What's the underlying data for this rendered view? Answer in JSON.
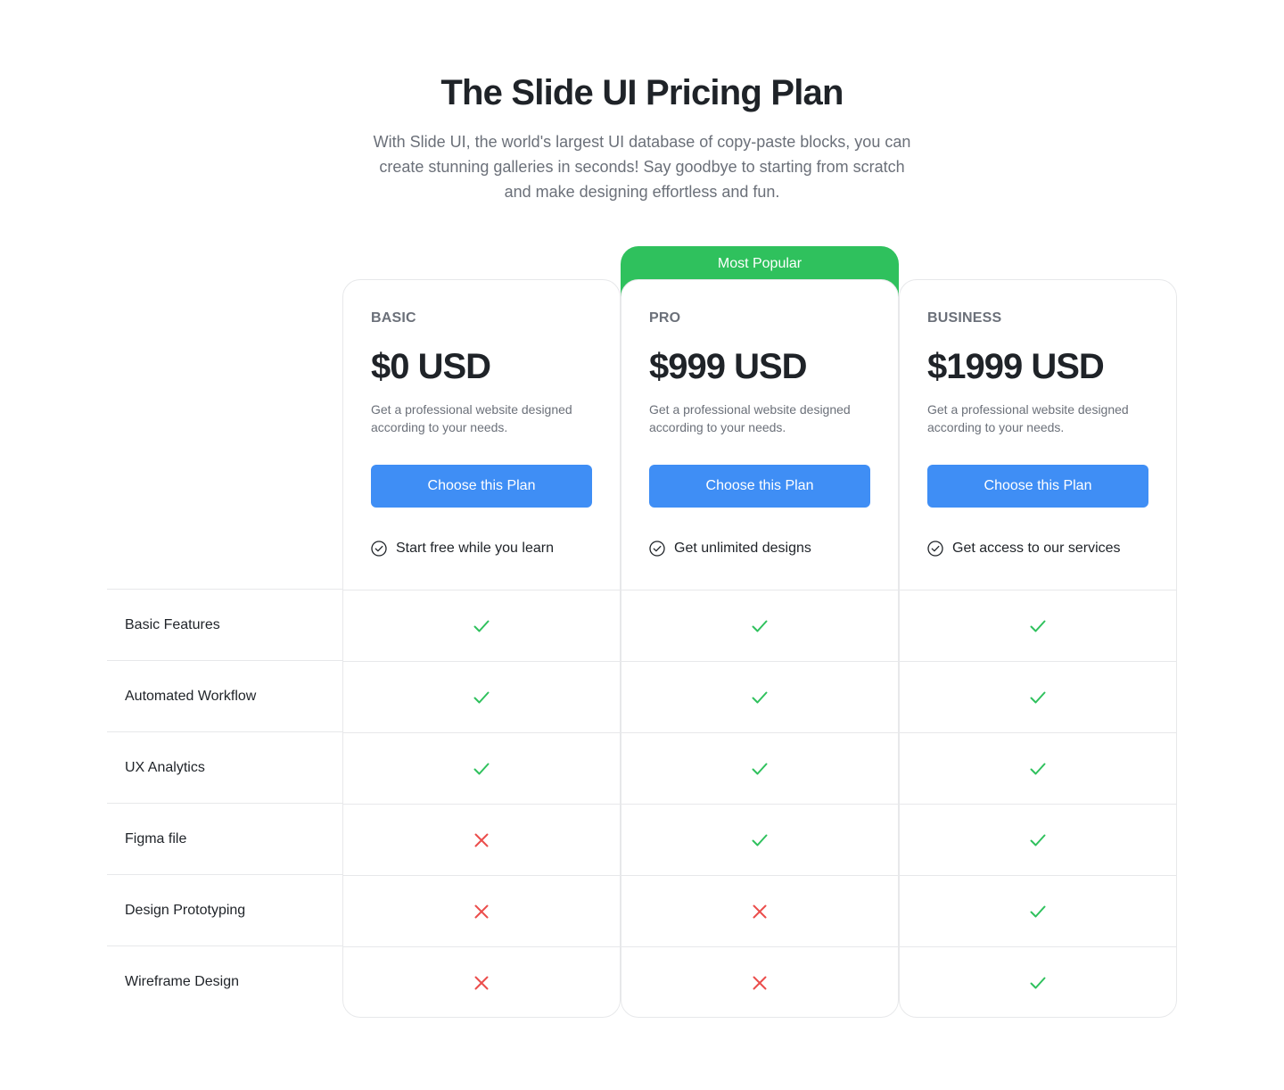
{
  "header": {
    "title": "The Slide UI Pricing Plan",
    "subtitle_lines": [
      "With Slide UI, the world's largest UI database of copy-paste blocks, you can",
      "create stunning galleries in seconds! Say goodbye to starting from scratch",
      "and make designing effortless and fun."
    ]
  },
  "badge": {
    "label": "Most Popular",
    "color": "#2fc15d"
  },
  "colors": {
    "button": "#3f8ef5",
    "check": "#2fc15d",
    "cross": "#eb4d4b"
  },
  "plans": [
    {
      "name": "BASIC",
      "price": "$0 USD",
      "description": "Get a professional website designed according to your needs.",
      "button_label": "Choose this Plan",
      "highlight": "Start free while you learn",
      "highlight_icon": "check-circle-icon"
    },
    {
      "name": "PRO",
      "price": "$999 USD",
      "description": "Get a professional website designed according to your needs.",
      "button_label": "Choose this Plan",
      "highlight": "Get unlimited designs",
      "highlight_icon": "check-circle-icon"
    },
    {
      "name": "BUSINESS",
      "price": "$1999 USD",
      "description": "Get a professional website designed according to your needs.",
      "button_label": "Choose this Plan",
      "highlight": "Get access to our services",
      "highlight_icon": "check-circle-icon"
    }
  ],
  "features": [
    {
      "label": "Basic Features",
      "included": [
        true,
        true,
        true
      ]
    },
    {
      "label": "Automated Workflow",
      "included": [
        true,
        true,
        true
      ]
    },
    {
      "label": "UX Analytics",
      "included": [
        true,
        true,
        true
      ]
    },
    {
      "label": "Figma file",
      "included": [
        false,
        true,
        true
      ]
    },
    {
      "label": "Design Prototyping",
      "included": [
        false,
        false,
        true
      ]
    },
    {
      "label": "Wireframe Design",
      "included": [
        false,
        false,
        true
      ]
    }
  ]
}
